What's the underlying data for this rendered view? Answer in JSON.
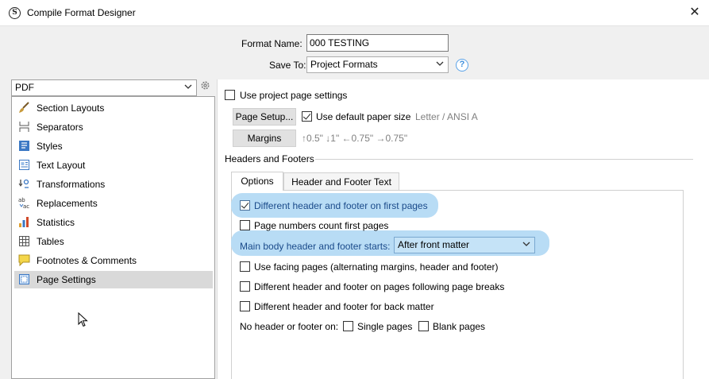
{
  "window": {
    "title": "Compile Format Designer",
    "app_icon_letter": "S",
    "close_glyph": "✕"
  },
  "header": {
    "format_name_label": "Format Name:",
    "format_name_value": "000 TESTING",
    "save_to_label": "Save To:",
    "save_to_value": "Project Formats",
    "help_glyph": "?"
  },
  "output_select": {
    "value": "PDF"
  },
  "sidebar": {
    "items": [
      {
        "label": "Section Layouts",
        "icon": "brush-icon"
      },
      {
        "label": "Separators",
        "icon": "separators-icon"
      },
      {
        "label": "Styles",
        "icon": "styles-icon"
      },
      {
        "label": "Text Layout",
        "icon": "text-layout-icon"
      },
      {
        "label": "Transformations",
        "icon": "transformations-icon"
      },
      {
        "label": "Replacements",
        "icon": "replacements-icon"
      },
      {
        "label": "Statistics",
        "icon": "statistics-icon"
      },
      {
        "label": "Tables",
        "icon": "tables-icon"
      },
      {
        "label": "Footnotes & Comments",
        "icon": "footnotes-icon"
      },
      {
        "label": "Page Settings",
        "icon": "page-settings-icon",
        "selected": true
      }
    ]
  },
  "page": {
    "use_project_page_settings": "Use project page settings",
    "page_setup_button": "Page Setup...",
    "use_default_paper_size": "Use default paper size",
    "paper_size": "Letter / ANSI A",
    "margins_button": "Margins",
    "margins_values": "↑0.5\" ↓1\" ←0.75\" →0.75\"",
    "headers_footers_heading": "Headers and Footers"
  },
  "tabs": [
    {
      "label": "Options",
      "active": true
    },
    {
      "label": "Header and Footer Text",
      "active": false
    }
  ],
  "options": {
    "diff_first_pages": "Different header and footer on first pages",
    "page_numbers_count": "Page numbers count first pages",
    "main_body_starts_label": "Main body header and footer starts:",
    "main_body_starts_value": "After front matter",
    "facing_pages": "Use facing pages (alternating margins, header and footer)",
    "diff_following_breaks": "Different header and footer on pages following page breaks",
    "diff_back_matter": "Different header and footer for back matter",
    "no_header_label": "No header or footer on:",
    "single_pages": "Single pages",
    "blank_pages": "Blank pages"
  },
  "colors": {
    "highlight": "#b8dcf5",
    "selected_row": "#d9d9d9",
    "accent": "#3f8fdc"
  }
}
